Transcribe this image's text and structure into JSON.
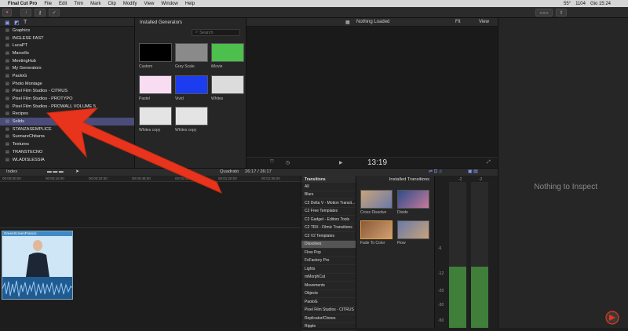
{
  "menubar": {
    "app": "Final Cut Pro",
    "items": [
      "File",
      "Edit",
      "Trim",
      "Mark",
      "Clip",
      "Modify",
      "View",
      "Window",
      "Help"
    ],
    "battery": "55°",
    "wifi": "1104",
    "clock": "Gio 15:24"
  },
  "browser": {
    "items": [
      {
        "label": "Graphics"
      },
      {
        "label": "INGLESE FAST"
      },
      {
        "label": "LucaPT"
      },
      {
        "label": "Marcello"
      },
      {
        "label": "MeetingHub"
      },
      {
        "label": "My Generators"
      },
      {
        "label": "PaoloG"
      },
      {
        "label": "Photo Montage"
      },
      {
        "label": "Pixel Film Studios - CITRUS"
      },
      {
        "label": "Pixel Film Studios - PROTYPO"
      },
      {
        "label": "Pixel Film Studios - PROWALL VOLUME 5"
      },
      {
        "label": "Recipes"
      },
      {
        "label": "Solids"
      },
      {
        "label": "STANZASEMPLICE"
      },
      {
        "label": "SuonareChitarra"
      },
      {
        "label": "Textures"
      },
      {
        "label": "TRANSTECNO"
      },
      {
        "label": "WLADISLESSIA"
      }
    ],
    "selected": "Solids"
  },
  "generators": {
    "title": "Installed Generators",
    "search_placeholder": "Search",
    "tiles": [
      {
        "label": "Custom",
        "color": "#000000"
      },
      {
        "label": "Gray Scale",
        "color": "#8a8a8a"
      },
      {
        "label": "iMovie",
        "color": "#4cbf4c"
      },
      {
        "label": "Pastel",
        "color": "#f7dcf2"
      },
      {
        "label": "Vivid",
        "color": "#1c3cf0"
      },
      {
        "label": "Whites",
        "color": "#dcdcdc"
      },
      {
        "label": "Whites copy",
        "color": "#e4e4e4"
      },
      {
        "label": "Whites copy",
        "color": "#e4e4e4"
      }
    ]
  },
  "viewer": {
    "status": "Nothing Loaded",
    "fit": "Fit",
    "view": "View",
    "timecode": "13:19"
  },
  "inspector": {
    "message": "Nothing to Inspect"
  },
  "timeline": {
    "index_label": "Index",
    "project": "Quadrato",
    "duration": "26:17 / 26:17",
    "ruler": [
      "00:00:00:00",
      "00:00:16:00",
      "00:00:32:00",
      "00:00:48:00",
      "00:01:04:00",
      "00:01:20:00",
      "00:01:36:00"
    ],
    "clip_name": "GreenScreenFrancis"
  },
  "transitions": {
    "header": "Transitions",
    "items": [
      "All",
      "Blurs",
      "C2 Delta V - Motion Transit...",
      "C2 Free Templates",
      "C2 Gadget - Editors Tools",
      "C2 TRX - Filmic Transitions",
      "C2 V2 Templates",
      "Dissolves",
      "Flow Pop",
      "FxFactory Pro",
      "Lights",
      "mMorphCut",
      "Movements",
      "Objects",
      "PaoloG",
      "Pixel Film Studios - CITRUS",
      "Replicator/Clones",
      "Ripple"
    ],
    "selected": "Dissolves",
    "panel_title": "Installed Transitions",
    "tiles": [
      {
        "label": "Cross Dissolve"
      },
      {
        "label": "Divide"
      },
      {
        "label": "Fade To Color"
      },
      {
        "label": "Flow"
      }
    ]
  },
  "meters": {
    "labels": [
      "-6",
      "-12",
      "-20",
      "-30",
      "-50"
    ],
    "channel_labels": [
      "-2",
      "-2"
    ]
  },
  "colors": {
    "accent_arrow": "#e8341c",
    "selection": "#4a4d7a",
    "meter_green": "#3f7f3a"
  }
}
